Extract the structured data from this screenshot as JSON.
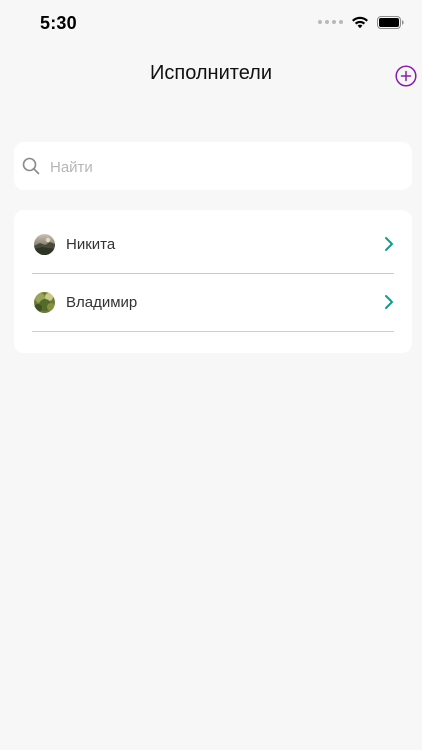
{
  "status_bar": {
    "time": "5:30"
  },
  "header": {
    "title": "Исполнители",
    "add_icon": "plus-circle-icon",
    "accent_color": "#8a1ea5"
  },
  "search": {
    "placeholder": "Найти",
    "value": "",
    "icon": "search-icon"
  },
  "performers": {
    "items": [
      {
        "name": "Никита",
        "avatar": "avatar-photo-landscape",
        "chevron": "chevron-right-icon"
      },
      {
        "name": "Владимир",
        "avatar": "avatar-photo-foliage",
        "chevron": "chevron-right-icon"
      }
    ],
    "chevron_color": "#149a8c"
  }
}
